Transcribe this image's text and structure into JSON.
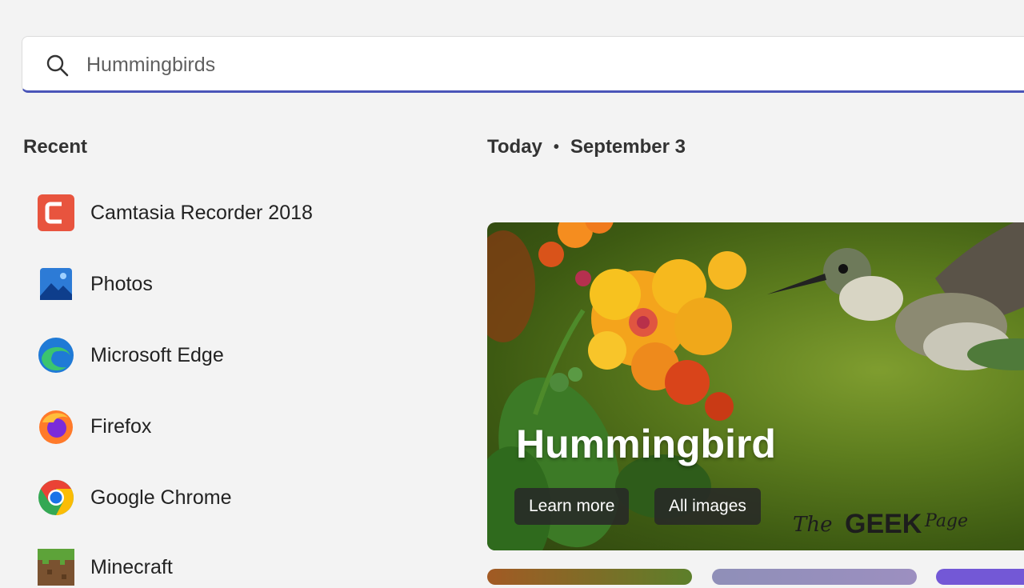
{
  "search": {
    "value": "Hummingbirds",
    "icon": "search-icon"
  },
  "recent": {
    "title": "Recent",
    "items": [
      {
        "label": "Camtasia Recorder 2018",
        "icon": "camtasia-icon"
      },
      {
        "label": "Photos",
        "icon": "photos-icon"
      },
      {
        "label": "Microsoft Edge",
        "icon": "edge-icon"
      },
      {
        "label": "Firefox",
        "icon": "firefox-icon"
      },
      {
        "label": "Google Chrome",
        "icon": "chrome-icon"
      },
      {
        "label": "Minecraft",
        "icon": "minecraft-icon"
      }
    ]
  },
  "today": {
    "label": "Today",
    "separator": "•",
    "date": "September 3"
  },
  "hero": {
    "title": "Hummingbird",
    "learn_more": "Learn more",
    "all_images": "All images",
    "watermark": {
      "the": "The",
      "geek": "GEEK",
      "page": "Page"
    }
  },
  "colors": {
    "accent": "#4a55b8",
    "background": "#f3f3f3"
  }
}
